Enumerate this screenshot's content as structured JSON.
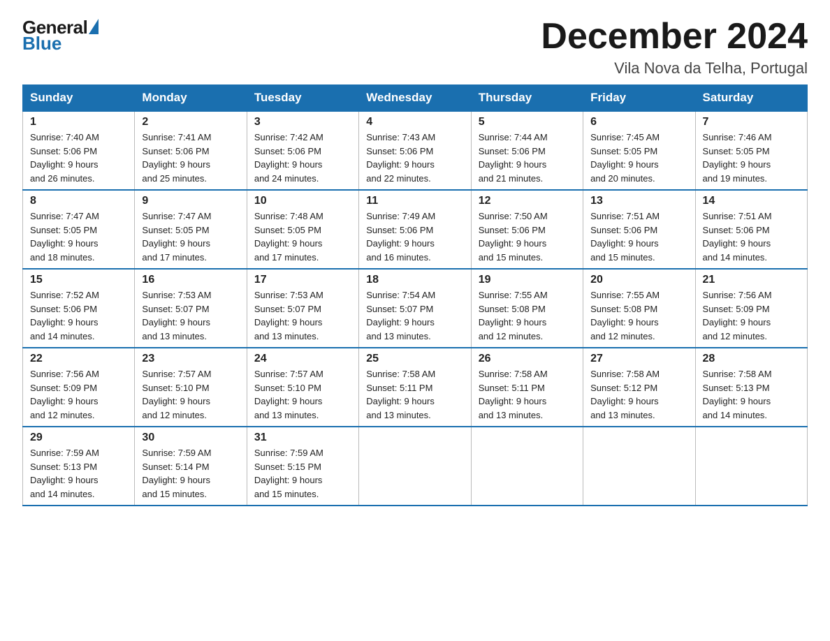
{
  "logo": {
    "general": "General",
    "blue": "Blue"
  },
  "title": "December 2024",
  "location": "Vila Nova da Telha, Portugal",
  "days_of_week": [
    "Sunday",
    "Monday",
    "Tuesday",
    "Wednesday",
    "Thursday",
    "Friday",
    "Saturday"
  ],
  "weeks": [
    [
      {
        "day": "1",
        "sunrise": "7:40 AM",
        "sunset": "5:06 PM",
        "daylight": "9 hours and 26 minutes."
      },
      {
        "day": "2",
        "sunrise": "7:41 AM",
        "sunset": "5:06 PM",
        "daylight": "9 hours and 25 minutes."
      },
      {
        "day": "3",
        "sunrise": "7:42 AM",
        "sunset": "5:06 PM",
        "daylight": "9 hours and 24 minutes."
      },
      {
        "day": "4",
        "sunrise": "7:43 AM",
        "sunset": "5:06 PM",
        "daylight": "9 hours and 22 minutes."
      },
      {
        "day": "5",
        "sunrise": "7:44 AM",
        "sunset": "5:06 PM",
        "daylight": "9 hours and 21 minutes."
      },
      {
        "day": "6",
        "sunrise": "7:45 AM",
        "sunset": "5:05 PM",
        "daylight": "9 hours and 20 minutes."
      },
      {
        "day": "7",
        "sunrise": "7:46 AM",
        "sunset": "5:05 PM",
        "daylight": "9 hours and 19 minutes."
      }
    ],
    [
      {
        "day": "8",
        "sunrise": "7:47 AM",
        "sunset": "5:05 PM",
        "daylight": "9 hours and 18 minutes."
      },
      {
        "day": "9",
        "sunrise": "7:47 AM",
        "sunset": "5:05 PM",
        "daylight": "9 hours and 17 minutes."
      },
      {
        "day": "10",
        "sunrise": "7:48 AM",
        "sunset": "5:05 PM",
        "daylight": "9 hours and 17 minutes."
      },
      {
        "day": "11",
        "sunrise": "7:49 AM",
        "sunset": "5:06 PM",
        "daylight": "9 hours and 16 minutes."
      },
      {
        "day": "12",
        "sunrise": "7:50 AM",
        "sunset": "5:06 PM",
        "daylight": "9 hours and 15 minutes."
      },
      {
        "day": "13",
        "sunrise": "7:51 AM",
        "sunset": "5:06 PM",
        "daylight": "9 hours and 15 minutes."
      },
      {
        "day": "14",
        "sunrise": "7:51 AM",
        "sunset": "5:06 PM",
        "daylight": "9 hours and 14 minutes."
      }
    ],
    [
      {
        "day": "15",
        "sunrise": "7:52 AM",
        "sunset": "5:06 PM",
        "daylight": "9 hours and 14 minutes."
      },
      {
        "day": "16",
        "sunrise": "7:53 AM",
        "sunset": "5:07 PM",
        "daylight": "9 hours and 13 minutes."
      },
      {
        "day": "17",
        "sunrise": "7:53 AM",
        "sunset": "5:07 PM",
        "daylight": "9 hours and 13 minutes."
      },
      {
        "day": "18",
        "sunrise": "7:54 AM",
        "sunset": "5:07 PM",
        "daylight": "9 hours and 13 minutes."
      },
      {
        "day": "19",
        "sunrise": "7:55 AM",
        "sunset": "5:08 PM",
        "daylight": "9 hours and 12 minutes."
      },
      {
        "day": "20",
        "sunrise": "7:55 AM",
        "sunset": "5:08 PM",
        "daylight": "9 hours and 12 minutes."
      },
      {
        "day": "21",
        "sunrise": "7:56 AM",
        "sunset": "5:09 PM",
        "daylight": "9 hours and 12 minutes."
      }
    ],
    [
      {
        "day": "22",
        "sunrise": "7:56 AM",
        "sunset": "5:09 PM",
        "daylight": "9 hours and 12 minutes."
      },
      {
        "day": "23",
        "sunrise": "7:57 AM",
        "sunset": "5:10 PM",
        "daylight": "9 hours and 12 minutes."
      },
      {
        "day": "24",
        "sunrise": "7:57 AM",
        "sunset": "5:10 PM",
        "daylight": "9 hours and 13 minutes."
      },
      {
        "day": "25",
        "sunrise": "7:58 AM",
        "sunset": "5:11 PM",
        "daylight": "9 hours and 13 minutes."
      },
      {
        "day": "26",
        "sunrise": "7:58 AM",
        "sunset": "5:11 PM",
        "daylight": "9 hours and 13 minutes."
      },
      {
        "day": "27",
        "sunrise": "7:58 AM",
        "sunset": "5:12 PM",
        "daylight": "9 hours and 13 minutes."
      },
      {
        "day": "28",
        "sunrise": "7:58 AM",
        "sunset": "5:13 PM",
        "daylight": "9 hours and 14 minutes."
      }
    ],
    [
      {
        "day": "29",
        "sunrise": "7:59 AM",
        "sunset": "5:13 PM",
        "daylight": "9 hours and 14 minutes."
      },
      {
        "day": "30",
        "sunrise": "7:59 AM",
        "sunset": "5:14 PM",
        "daylight": "9 hours and 15 minutes."
      },
      {
        "day": "31",
        "sunrise": "7:59 AM",
        "sunset": "5:15 PM",
        "daylight": "9 hours and 15 minutes."
      },
      null,
      null,
      null,
      null
    ]
  ],
  "labels": {
    "sunrise": "Sunrise:",
    "sunset": "Sunset:",
    "daylight": "Daylight:"
  }
}
